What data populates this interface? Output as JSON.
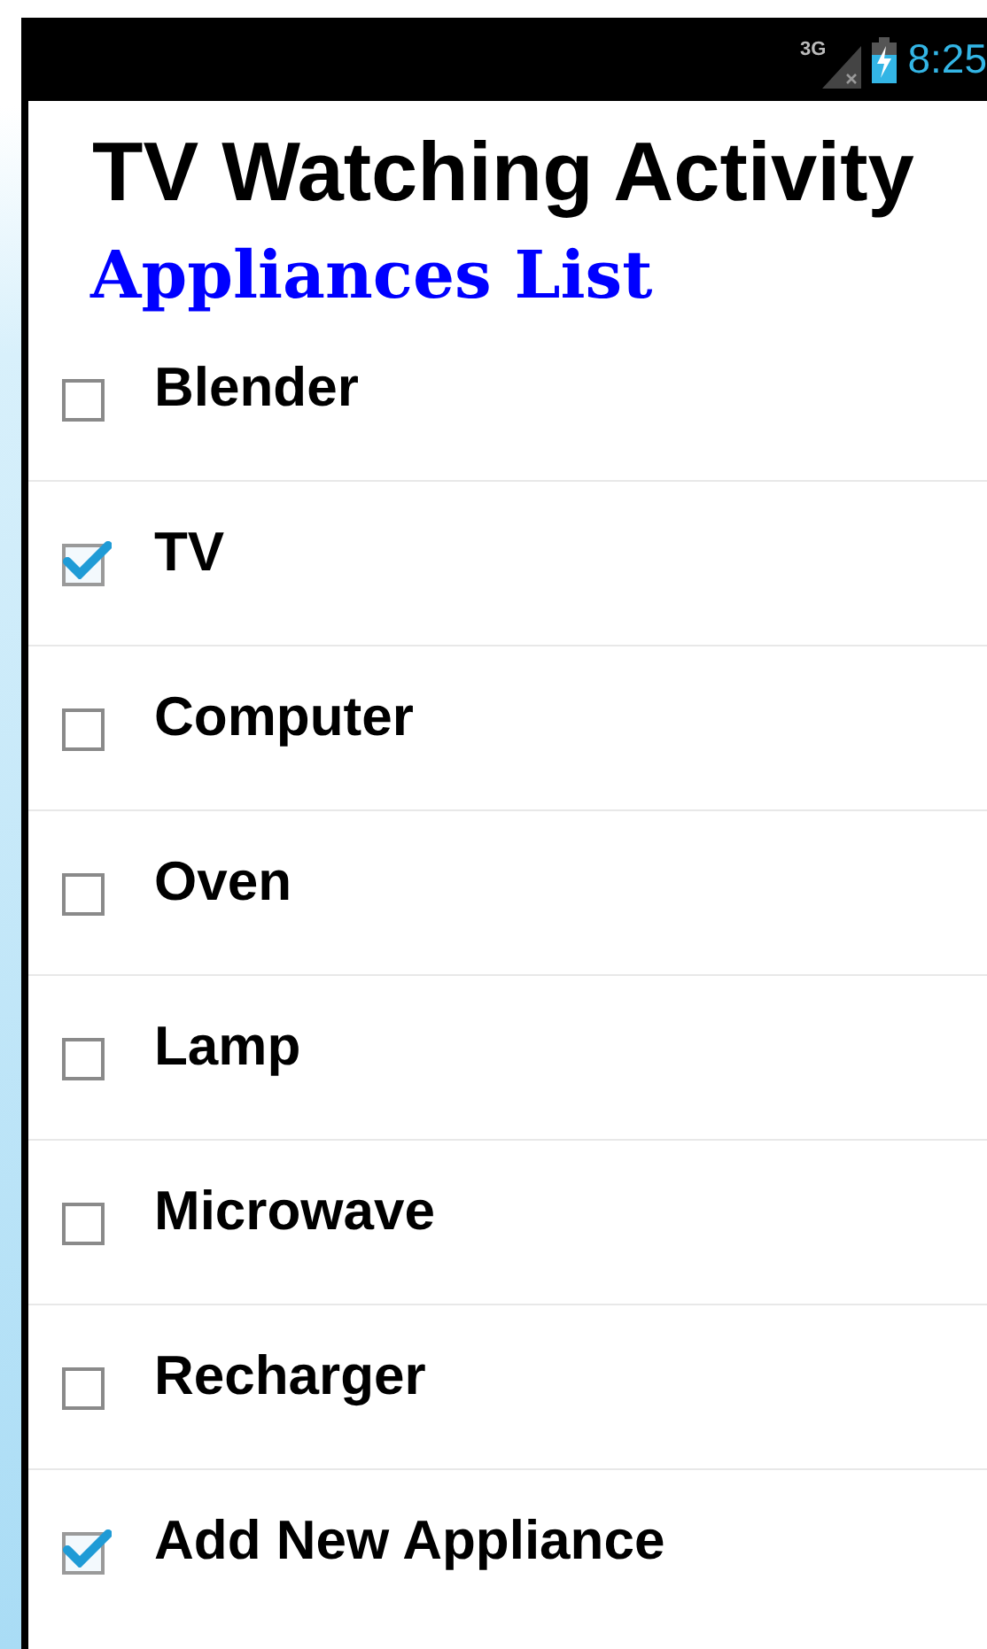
{
  "status_bar": {
    "network": "3G",
    "time": "8:25"
  },
  "title": "TV Watching Activity",
  "subtitle": "Appliances List",
  "items": [
    {
      "label": "Blender",
      "checked": false
    },
    {
      "label": "TV",
      "checked": true
    },
    {
      "label": "Computer",
      "checked": false
    },
    {
      "label": "Oven",
      "checked": false
    },
    {
      "label": "Lamp",
      "checked": false
    },
    {
      "label": "Microwave",
      "checked": false
    },
    {
      "label": "Recharger",
      "checked": false
    },
    {
      "label": "Add New Appliance",
      "checked": true
    }
  ]
}
